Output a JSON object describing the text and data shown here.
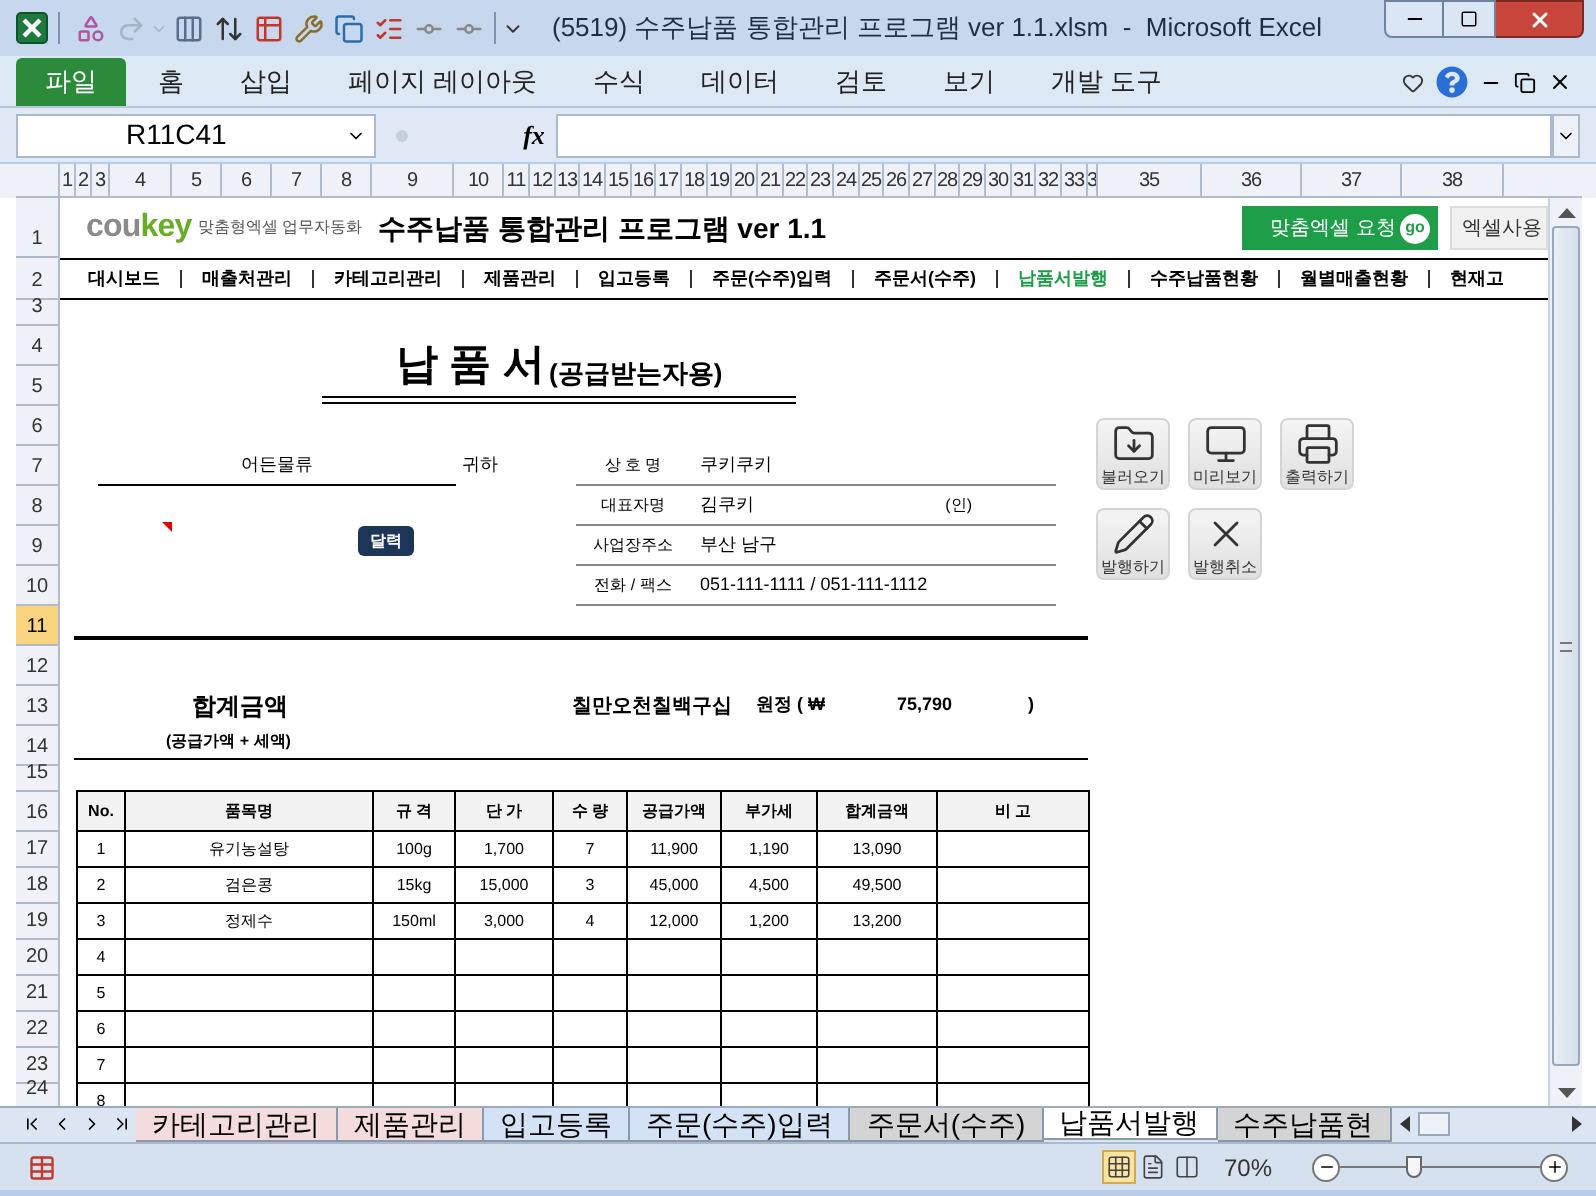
{
  "window": {
    "title": "(5519) 수주납품 통합관리 프로그램 ver 1.1.xlsm  -  Microsoft Excel"
  },
  "ribbon_tabs": [
    {
      "label": "파일",
      "kind": "file"
    },
    {
      "label": "홈",
      "kind": "tab"
    },
    {
      "label": "삽입",
      "kind": "tab"
    },
    {
      "label": "페이지 레이아웃",
      "kind": "tab"
    },
    {
      "label": "수식",
      "kind": "tab"
    },
    {
      "label": "데이터",
      "kind": "tab"
    },
    {
      "label": "검토",
      "kind": "tab"
    },
    {
      "label": "보기",
      "kind": "tab"
    },
    {
      "label": "개발 도구",
      "kind": "tab"
    }
  ],
  "formula_bar": {
    "name_box": "R11C41",
    "function_label": "fx"
  },
  "column_headers": [
    "1",
    "2",
    "3",
    "4",
    "5",
    "6",
    "7",
    "8",
    "9",
    "10",
    "11",
    "12",
    "13",
    "14",
    "15",
    "16",
    "17",
    "18",
    "19",
    "20",
    "21",
    "22",
    "23",
    "24",
    "25",
    "26",
    "27",
    "28",
    "29",
    "30",
    "31",
    "32",
    "33",
    "3",
    "35",
    "36",
    "37",
    "38"
  ],
  "row_headers": [
    {
      "label": "1",
      "selected": false
    },
    {
      "label": "2",
      "selected": false
    },
    {
      "label": "3",
      "selected": false
    },
    {
      "label": "4",
      "selected": false
    },
    {
      "label": "5",
      "selected": false
    },
    {
      "label": "6",
      "selected": false
    },
    {
      "label": "7",
      "selected": false
    },
    {
      "label": "8",
      "selected": false
    },
    {
      "label": "9",
      "selected": false
    },
    {
      "label": "10",
      "selected": false
    },
    {
      "label": "11",
      "selected": true
    },
    {
      "label": "12",
      "selected": false
    },
    {
      "label": "13",
      "selected": false
    },
    {
      "label": "14",
      "selected": false
    },
    {
      "label": "15",
      "selected": false
    },
    {
      "label": "16",
      "selected": false
    },
    {
      "label": "17",
      "selected": false
    },
    {
      "label": "18",
      "selected": false
    },
    {
      "label": "19",
      "selected": false
    },
    {
      "label": "20",
      "selected": false
    },
    {
      "label": "21",
      "selected": false
    },
    {
      "label": "22",
      "selected": false
    },
    {
      "label": "23",
      "selected": false
    },
    {
      "label": "24",
      "selected": false
    }
  ],
  "sheet": {
    "logo": {
      "brand_grey": "cou",
      "brand_green": "key",
      "tagline": "맞춤형엑셀 업무자동화"
    },
    "program_title": "수주납품 통합관리 프로그램 ver 1.1",
    "request_button": {
      "label": "맞춤엑셀 요청",
      "badge": "go"
    },
    "usage_button": "엑셀사용",
    "nav": [
      {
        "label": "대시보드",
        "selected": false
      },
      {
        "label": "매출처관리",
        "selected": false
      },
      {
        "label": "카테고리관리",
        "selected": false
      },
      {
        "label": "제품관리",
        "selected": false
      },
      {
        "label": "입고등록",
        "selected": false
      },
      {
        "label": "주문(수주)입력",
        "selected": false
      },
      {
        "label": "주문서(수주)",
        "selected": false
      },
      {
        "label": "납품서발행",
        "selected": true
      },
      {
        "label": "수주납품현황",
        "selected": false
      },
      {
        "label": "월별매출현황",
        "selected": false
      },
      {
        "label": "현재고",
        "selected": false
      }
    ],
    "document": {
      "title": "납 품 서",
      "subtitle": "(공급받는자용)",
      "recipient": "어든물류",
      "honorific": "귀하",
      "calendar_button": "달력",
      "supplier": [
        {
          "label": "상 호 명",
          "value": "쿠키쿠키"
        },
        {
          "label": "대표자명",
          "value": "김쿠키",
          "seal": "(인)"
        },
        {
          "label": "사업장주소",
          "value": "부산 남구"
        },
        {
          "label": "전화 / 팩스",
          "value": "051-111-1111 / 051-111-1112"
        }
      ],
      "total": {
        "label": "합계금액",
        "note": "(공급가액 + 세액)",
        "amount_words": "칠만오천칠백구십",
        "won_label": "원정 ( ₩",
        "amount": "75,790",
        "close": ")"
      }
    },
    "actions": [
      {
        "label": "불러오기",
        "kind": "folder"
      },
      {
        "label": "미리보기",
        "kind": "monitor"
      },
      {
        "label": "출력하기",
        "kind": "printer"
      },
      {
        "label": "발행하기",
        "kind": "pencil"
      },
      {
        "label": "발행취소",
        "kind": "cancel"
      }
    ],
    "table": {
      "columns": [
        "No.",
        "품목명",
        "규 격",
        "단 가",
        "수 량",
        "공급가액",
        "부가세",
        "합계금액",
        "비 고"
      ],
      "rows": [
        {
          "cells": [
            "1",
            "유기농설탕",
            "100g",
            "1,700",
            "7",
            "11,900",
            "1,190",
            "13,090"
          ]
        },
        {
          "cells": [
            "2",
            "검은콩",
            "15kg",
            "15,000",
            "3",
            "45,000",
            "4,500",
            "49,500"
          ]
        },
        {
          "cells": [
            "3",
            "정제수",
            "150ml",
            "3,000",
            "4",
            "12,000",
            "1,200",
            "13,200"
          ]
        },
        {
          "cells": [
            "4"
          ]
        },
        {
          "cells": [
            "5"
          ]
        },
        {
          "cells": [
            "6"
          ]
        },
        {
          "cells": [
            "7"
          ]
        },
        {
          "cells": [
            "8"
          ]
        }
      ]
    }
  },
  "sheet_tabs": [
    {
      "label": "카테고리관리",
      "color": "#f4dcdc",
      "selected": false
    },
    {
      "label": "제품관리",
      "color": "#f4dcdc",
      "selected": false
    },
    {
      "label": "입고등록",
      "color": "#d3e2f4",
      "selected": false
    },
    {
      "label": "주문(수주)입력",
      "color": "#d3e2f4",
      "selected": false
    },
    {
      "label": "주문서(수주)",
      "color": "#d4d4d4",
      "selected": false
    },
    {
      "label": "납품서발행",
      "color": "#ffffff",
      "selected": true
    },
    {
      "label": "수주납품현",
      "color": "#d4d4d4",
      "selected": false
    }
  ],
  "status_bar": {
    "views": [
      {
        "kind": "normal",
        "selected": true
      },
      {
        "kind": "page_layout",
        "selected": false
      },
      {
        "kind": "page_break",
        "selected": false
      }
    ],
    "zoom": {
      "label": "70%",
      "level": 0.37
    }
  }
}
